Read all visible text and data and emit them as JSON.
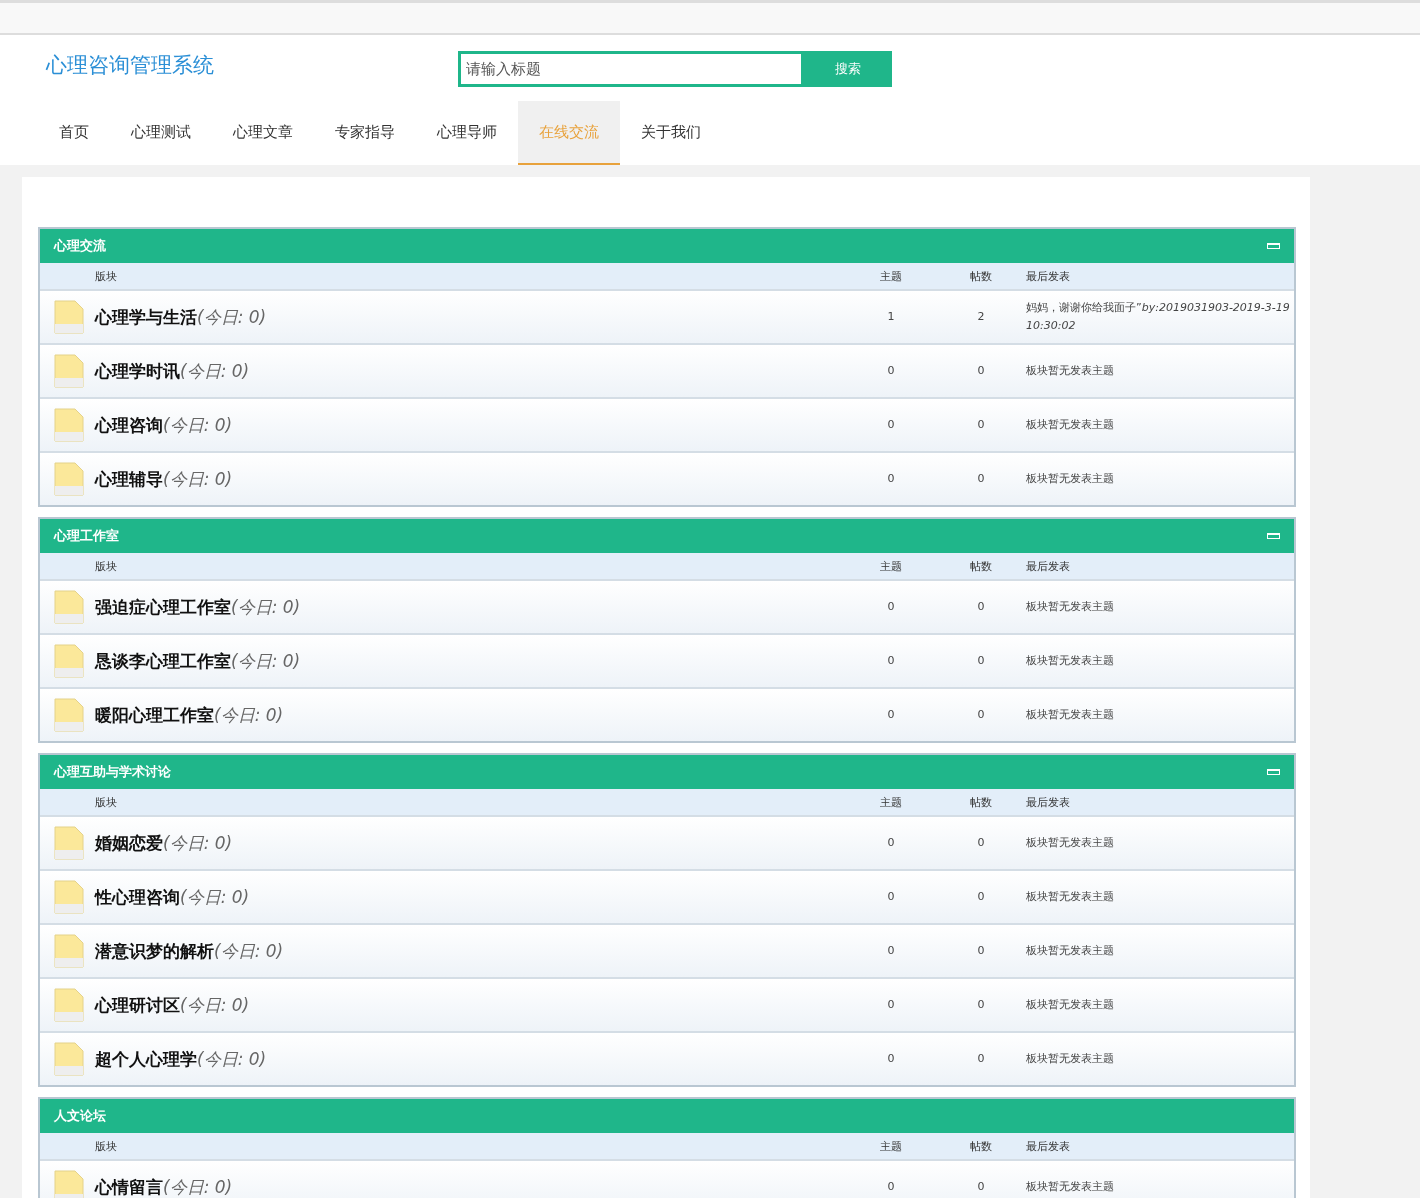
{
  "header": {
    "logo": "心理咨询管理系统",
    "search": {
      "placeholder": "请输入标题",
      "button": "搜索"
    }
  },
  "nav": [
    {
      "label": "首页",
      "selected": false
    },
    {
      "label": "心理测试",
      "selected": false
    },
    {
      "label": "心理文章",
      "selected": false
    },
    {
      "label": "专家指导",
      "selected": false
    },
    {
      "label": "心理导师",
      "selected": false
    },
    {
      "label": "在线交流",
      "selected": true
    },
    {
      "label": "关于我们",
      "selected": false
    }
  ],
  "groups": [
    {
      "title": "心理交流",
      "collapse_button": true,
      "columns": [
        "版块",
        "主题",
        "帖数",
        "最后发表"
      ],
      "forums": [
        {
          "name": "心理学与生活",
          "today": "(今日: 0)",
          "topics": "1",
          "posts": "2",
          "last_post": "妈妈，谢谢你给我面子”*by:2019031903-2019-3-19 10:30:02*"
        },
        {
          "name": "心理学时讯",
          "today": "(今日: 0)",
          "topics": "0",
          "posts": "0",
          "last_post": "板块暂无发表主题"
        },
        {
          "name": "心理咨询",
          "today": "(今日: 0)",
          "topics": "0",
          "posts": "0",
          "last_post": "板块暂无发表主题"
        },
        {
          "name": "心理辅导",
          "today": "(今日: 0)",
          "topics": "0",
          "posts": "0",
          "last_post": "板块暂无发表主题"
        }
      ]
    },
    {
      "title": "心理工作室",
      "collapse_button": true,
      "columns": [
        "版块",
        "主题",
        "帖数",
        "最后发表"
      ],
      "forums": [
        {
          "name": "强迫症心理工作室",
          "today": "(今日: 0)",
          "topics": "0",
          "posts": "0",
          "last_post": "板块暂无发表主题"
        },
        {
          "name": "恳谈李心理工作室",
          "today": "(今日: 0)",
          "topics": "0",
          "posts": "0",
          "last_post": "板块暂无发表主题"
        },
        {
          "name": "暖阳心理工作室",
          "today": "(今日: 0)",
          "topics": "0",
          "posts": "0",
          "last_post": "板块暂无发表主题"
        }
      ]
    },
    {
      "title": "心理互助与学术讨论",
      "collapse_button": true,
      "columns": [
        "版块",
        "主题",
        "帖数",
        "最后发表"
      ],
      "forums": [
        {
          "name": "婚姻恋爱",
          "today": "(今日: 0)",
          "topics": "0",
          "posts": "0",
          "last_post": "板块暂无发表主题"
        },
        {
          "name": "性心理咨询",
          "today": "(今日: 0)",
          "topics": "0",
          "posts": "0",
          "last_post": "板块暂无发表主题"
        },
        {
          "name": "潜意识梦的解析",
          "today": "(今日: 0)",
          "topics": "0",
          "posts": "0",
          "last_post": "板块暂无发表主题"
        },
        {
          "name": "心理研讨区",
          "today": "(今日: 0)",
          "topics": "0",
          "posts": "0",
          "last_post": "板块暂无发表主题"
        },
        {
          "name": "超个人心理学",
          "today": "(今日: 0)",
          "topics": "0",
          "posts": "0",
          "last_post": "板块暂无发表主题"
        }
      ]
    },
    {
      "title": "人文论坛",
      "collapse_button": false,
      "columns": [
        "版块",
        "主题",
        "帖数",
        "最后发表"
      ],
      "forums": [
        {
          "name": "心情留言",
          "today": "(今日: 0)",
          "topics": "0",
          "posts": "0",
          "last_post": "板块暂无发表主题"
        }
      ]
    }
  ]
}
